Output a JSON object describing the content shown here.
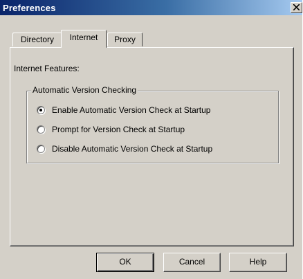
{
  "window": {
    "title": "Preferences",
    "close_symbol": "✕"
  },
  "tabs": [
    {
      "label": "Directory",
      "selected": false
    },
    {
      "label": "Internet",
      "selected": true
    },
    {
      "label": "Proxy",
      "selected": false
    }
  ],
  "internet": {
    "features_label": "Internet Features:",
    "group_title": "Automatic Version Checking",
    "options": [
      {
        "label": "Enable Automatic Version Check at Startup",
        "checked": true
      },
      {
        "label": "Prompt for Version Check at Startup",
        "checked": false
      },
      {
        "label": "Disable Automatic Version Check at Startup",
        "checked": false
      }
    ]
  },
  "buttons": {
    "ok": "OK",
    "cancel": "Cancel",
    "help": "Help"
  },
  "colors": {
    "title_gradient_start": "#0a246a",
    "title_gradient_end": "#a6caf0",
    "dialog_face": "#d4d0c8"
  }
}
